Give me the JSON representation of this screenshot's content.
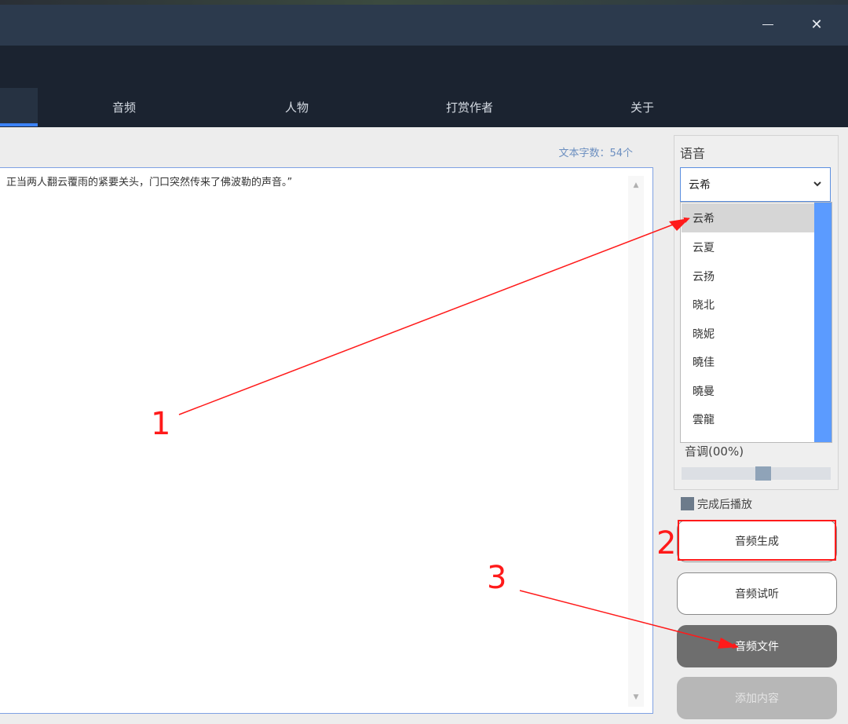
{
  "window": {
    "minimize_icon": "minimize-icon",
    "close_symbol": "✕"
  },
  "tabs": [
    {
      "label": "音频"
    },
    {
      "label": "人物"
    },
    {
      "label": "打赏作者"
    },
    {
      "label": "关于"
    }
  ],
  "editor": {
    "char_count": "文本字数：54个",
    "text": "正当两人翻云覆雨的紧要关头，门口突然传来了佛波勒的声音。”"
  },
  "voice_panel": {
    "label": "语音",
    "selected": "云希",
    "options": [
      "云希",
      "云夏",
      "云扬",
      "晓北",
      "晓妮",
      "曉佳",
      "曉曼",
      "雲龍"
    ],
    "pitch_label": "音调(00%)",
    "pitch_value": 0.55,
    "autoplay_label": "完成后播放"
  },
  "buttons": {
    "generate": "音频生成",
    "preview": "音频试听",
    "file": "音频文件",
    "add": "添加内容"
  },
  "annotations": {
    "one": "1",
    "two": "2",
    "three": "3",
    "color": "#ff1a1a"
  },
  "colors": {
    "titlebar": "#2c3a4d",
    "navbar": "#1b2330",
    "accent": "#3b82f6",
    "dropdown_scroll": "#5b9bff"
  }
}
